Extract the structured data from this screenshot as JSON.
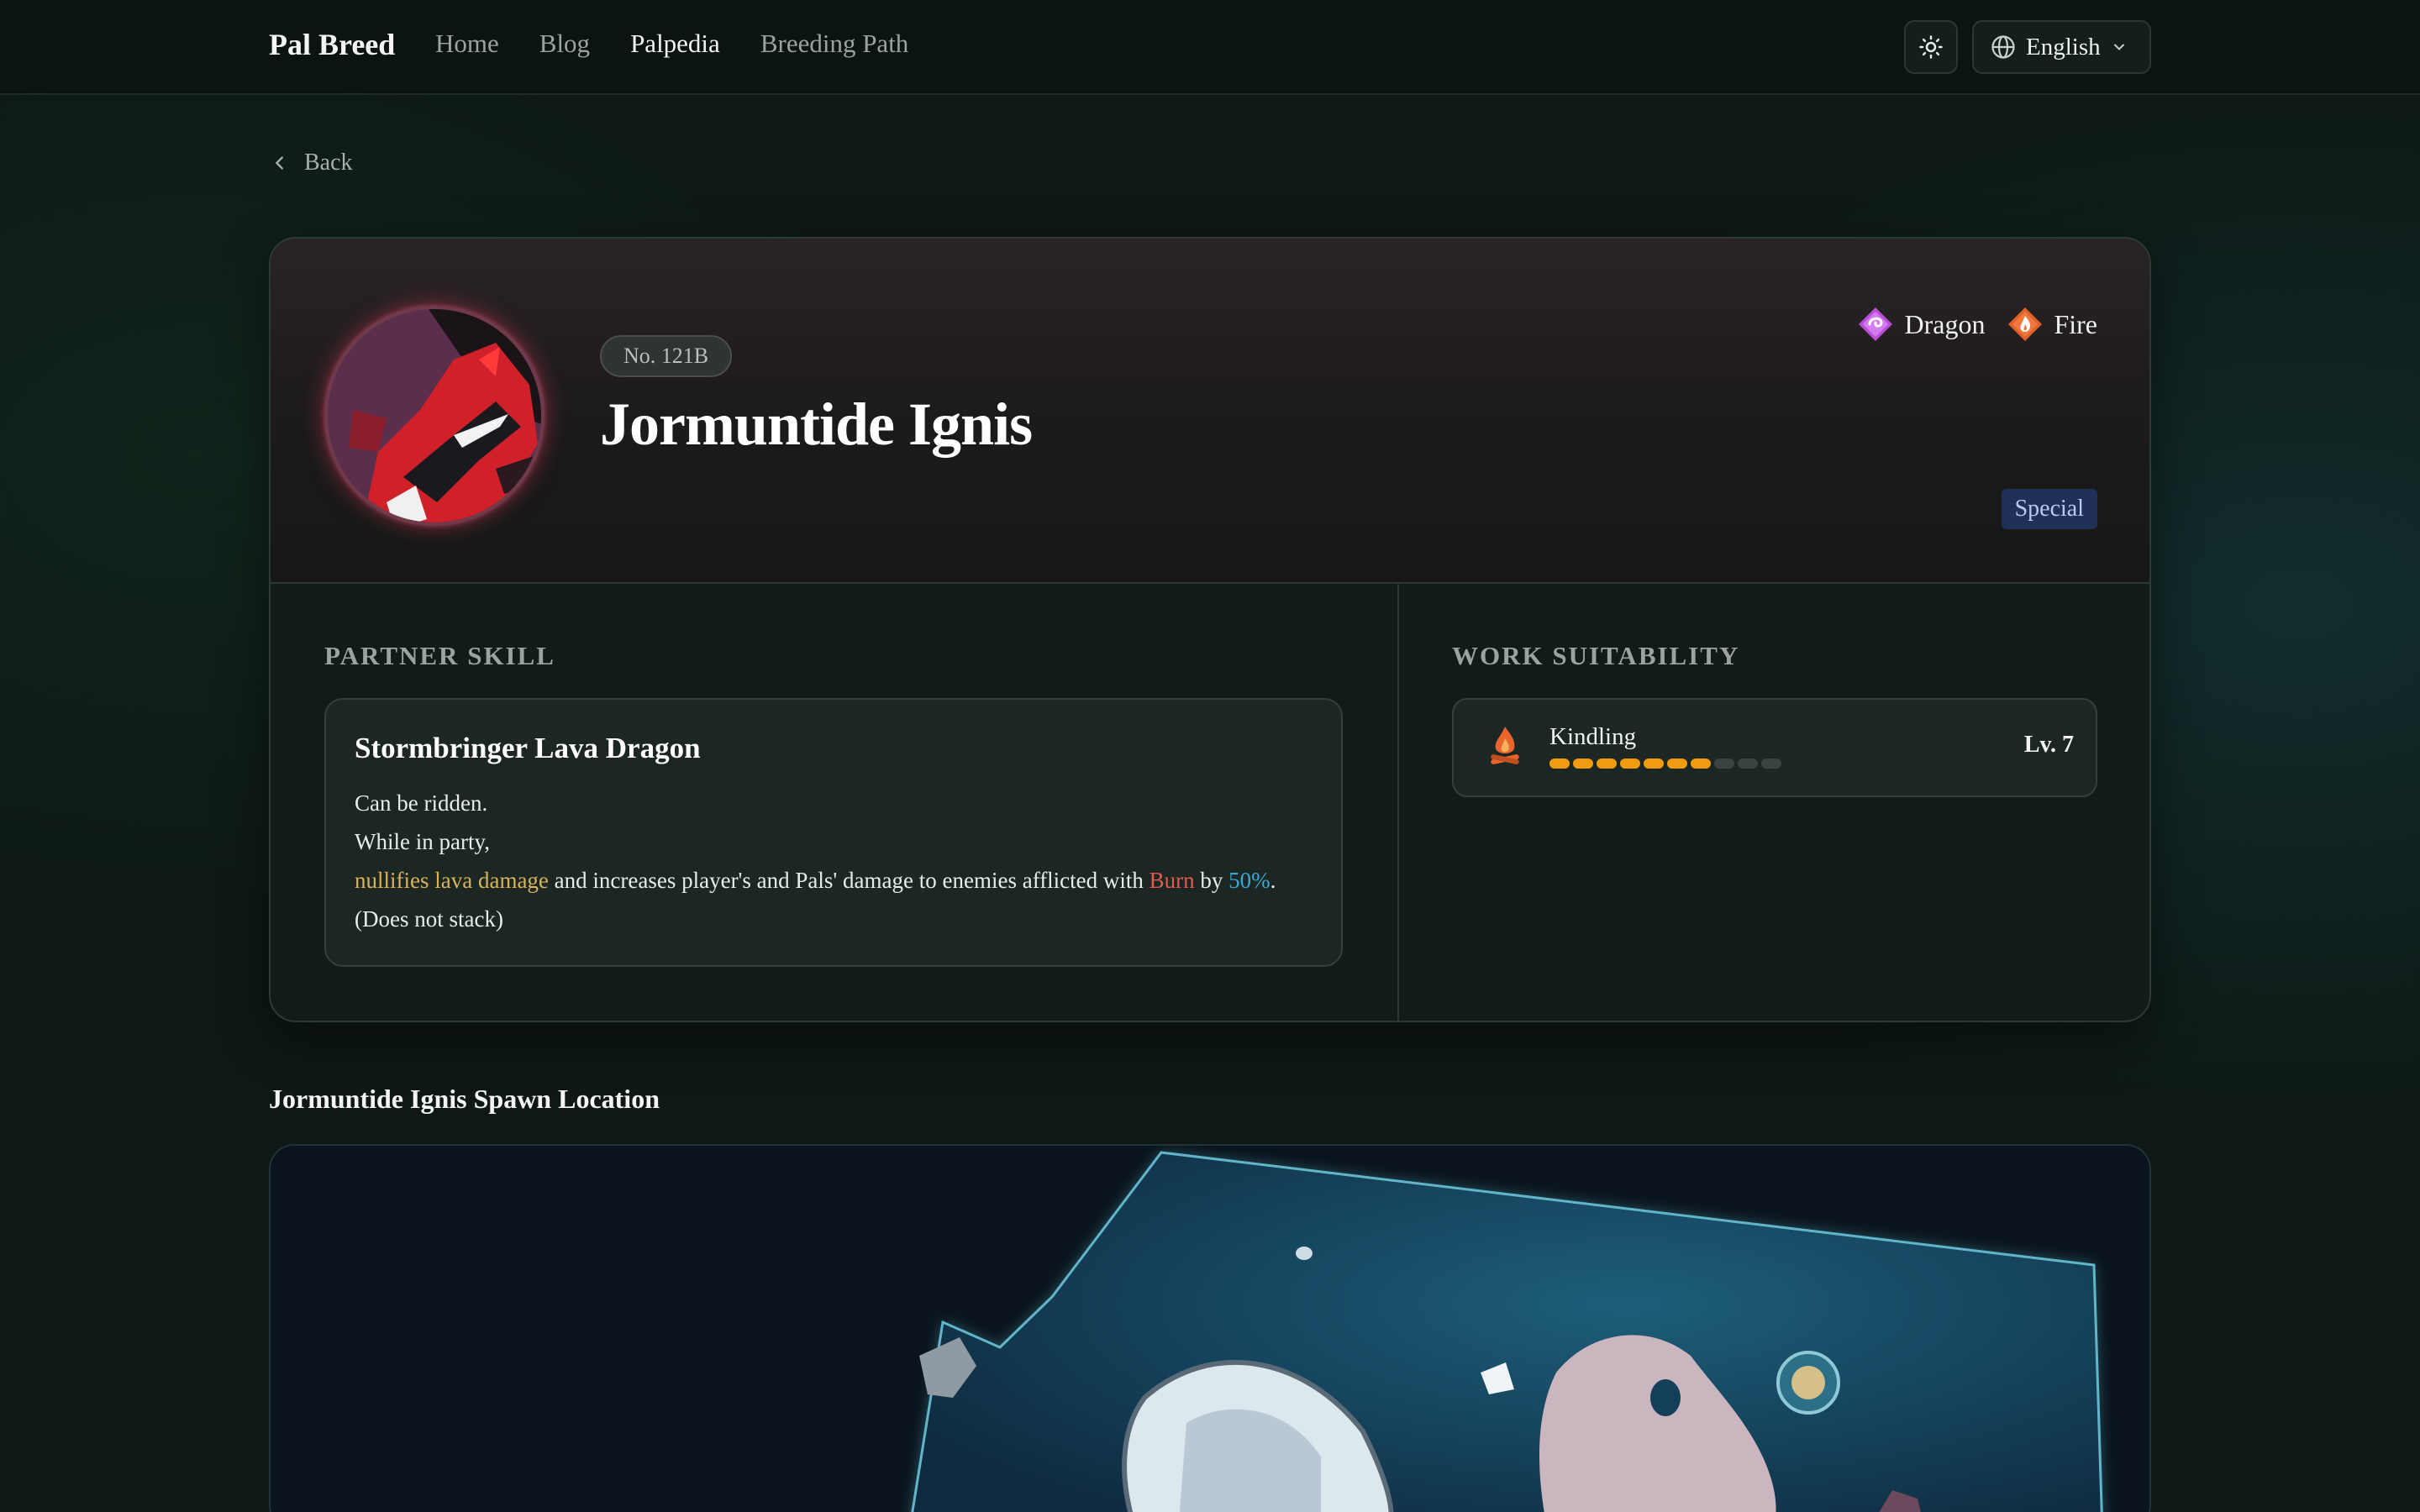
{
  "nav": {
    "brand": "Pal Breed",
    "links": [
      "Home",
      "Blog",
      "Palpedia",
      "Breeding Path"
    ],
    "language": "English"
  },
  "back_label": "Back",
  "pal": {
    "number": "No. 121B",
    "name": "Jormuntide Ignis",
    "types": [
      {
        "name": "Dragon",
        "color": "#b84fd6"
      },
      {
        "name": "Fire",
        "color": "#e0602c"
      }
    ],
    "rarity": "Special"
  },
  "partner_skill": {
    "section_title": "PARTNER SKILL",
    "name": "Stormbringer Lava Dragon",
    "line1": "Can be ridden.",
    "line2": "While in party,",
    "line3_a": "nullifies lava damage",
    "line3_b": " and increases player's and Pals' damage to enemies afflicted with ",
    "line3_c": "Burn",
    "line3_d": " by ",
    "line3_e": "50%",
    "line3_f": ".",
    "line4": "(Does not stack)"
  },
  "work": {
    "section_title": "WORK SUITABILITY",
    "items": [
      {
        "name": "Kindling",
        "level": "Lv. 7",
        "level_value": 7,
        "max": 10,
        "icon": "campfire-icon",
        "color": "#f39c12"
      }
    ]
  },
  "spawn": {
    "title": "Jormuntide Ignis Spawn Location"
  }
}
